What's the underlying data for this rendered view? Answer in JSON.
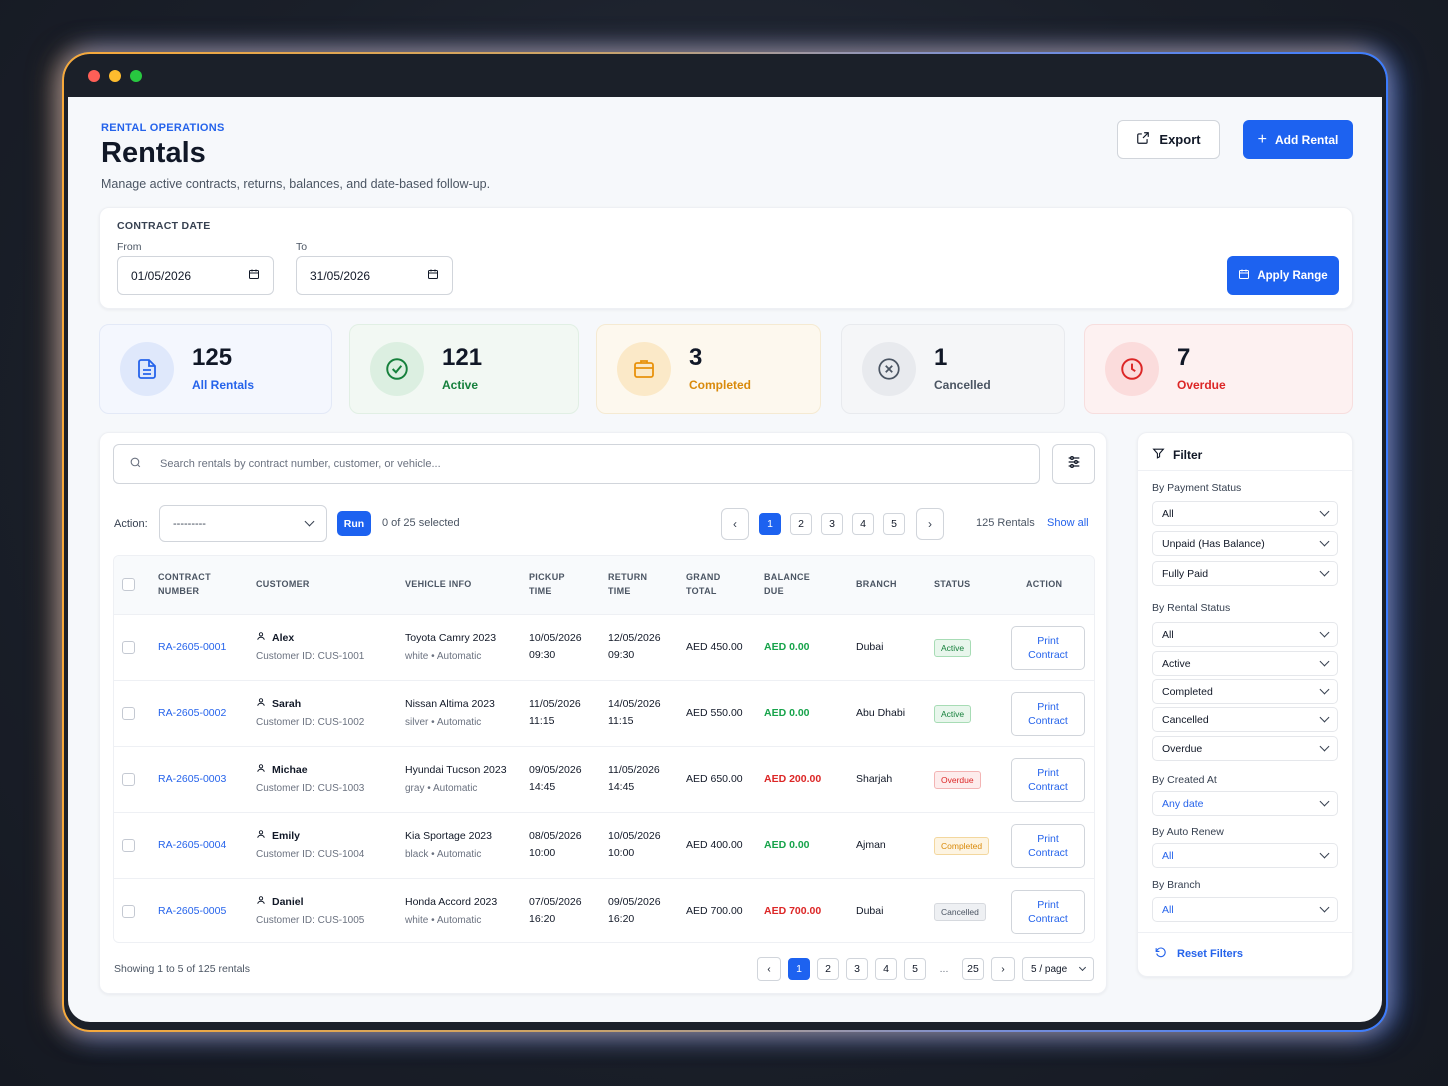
{
  "window": {
    "dot_colors": [
      "#ff5f57",
      "#febc2e",
      "#28c840"
    ]
  },
  "header": {
    "eyebrow": "RENTAL OPERATIONS",
    "title": "Rentals",
    "subtitle": "Manage active contracts, returns, balances, and date-based follow-up.",
    "export_label": "Export",
    "add_label": "Add Rental"
  },
  "date_range": {
    "section_label": "CONTRACT DATE",
    "from_label": "From",
    "from_value": "01/05/2026",
    "to_label": "To",
    "to_value": "31/05/2026",
    "apply_label": "Apply Range"
  },
  "stats": [
    {
      "value": "125",
      "label": "All Rentals",
      "color": "#2563eb"
    },
    {
      "value": "121",
      "label": "Active",
      "color": "#16803c"
    },
    {
      "value": "3",
      "label": "Completed",
      "color": "#d98a0b"
    },
    {
      "value": "1",
      "label": "Cancelled",
      "color": "#4b5563"
    },
    {
      "value": "7",
      "label": "Overdue",
      "color": "#dc2626"
    }
  ],
  "search": {
    "placeholder": "Search rentals by contract number, customer, or vehicle..."
  },
  "actions": {
    "action_label": "Action:",
    "action_value": "---------",
    "run_label": "Run",
    "selected_text": "0 of 25 selected",
    "top_pages": [
      "1",
      "2",
      "3",
      "4",
      "5"
    ],
    "total_text": "125 Rentals",
    "show_all": "Show all"
  },
  "table": {
    "headers": {
      "contract": "CONTRACT NUMBER",
      "customer": "CUSTOMER",
      "vehicle": "VEHICLE INFO",
      "pickup": "PICKUP TIME",
      "return": "RETURN TIME",
      "grand": "GRAND TOTAL",
      "balance": "BALANCE DUE",
      "branch": "BRANCH",
      "status": "STATUS",
      "action": "ACTION"
    },
    "rows": [
      {
        "contract": "RA-2605-0001",
        "name": "Alex",
        "cid": "Customer ID: CUS-1001",
        "vehicle": "Toyota Camry 2023",
        "spec": "white • Automatic",
        "pickup_date": "10/05/2026",
        "pickup_time": "09:30",
        "return_date": "12/05/2026",
        "return_time": "09:30",
        "grand": "AED 450.00",
        "balance": "AED 0.00",
        "balance_color": "#16a34a",
        "branch": "Dubai",
        "status": "Active",
        "status_kind": "active",
        "print1": "Print",
        "print2": "Contract"
      },
      {
        "contract": "RA-2605-0002",
        "name": "Sarah",
        "cid": "Customer ID: CUS-1002",
        "vehicle": "Nissan Altima 2023",
        "spec": "silver • Automatic",
        "pickup_date": "11/05/2026",
        "pickup_time": "11:15",
        "return_date": "14/05/2026",
        "return_time": "11:15",
        "grand": "AED 550.00",
        "balance": "AED 0.00",
        "balance_color": "#16a34a",
        "branch": "Abu Dhabi",
        "status": "Active",
        "status_kind": "active",
        "print1": "Print",
        "print2": "Contract"
      },
      {
        "contract": "RA-2605-0003",
        "name": "Michae",
        "cid": "Customer ID: CUS-1003",
        "vehicle": "Hyundai Tucson 2023",
        "spec": "gray • Automatic",
        "pickup_date": "09/05/2026",
        "pickup_time": "14:45",
        "return_date": "11/05/2026",
        "return_time": "14:45",
        "grand": "AED 650.00",
        "balance": "AED 200.00",
        "balance_color": "#dc2626",
        "branch": "Sharjah",
        "status": "Overdue",
        "status_kind": "overdue",
        "print1": "Print",
        "print2": "Contract"
      },
      {
        "contract": "RA-2605-0004",
        "name": "Emily",
        "cid": "Customer ID: CUS-1004",
        "vehicle": "Kia Sportage 2023",
        "spec": "black • Automatic",
        "pickup_date": "08/05/2026",
        "pickup_time": "10:00",
        "return_date": "10/05/2026",
        "return_time": "10:00",
        "grand": "AED 400.00",
        "balance": "AED 0.00",
        "balance_color": "#16a34a",
        "branch": "Ajman",
        "status": "Completed",
        "status_kind": "completed",
        "print1": "Print",
        "print2": "Contract"
      },
      {
        "contract": "RA-2605-0005",
        "name": "Daniel",
        "cid": "Customer ID: CUS-1005",
        "vehicle": "Honda Accord 2023",
        "spec": "white • Automatic",
        "pickup_date": "07/05/2026",
        "pickup_time": "16:20",
        "return_date": "09/05/2026",
        "return_time": "16:20",
        "grand": "AED 700.00",
        "balance": "AED 700.00",
        "balance_color": "#dc2626",
        "branch": "Dubai",
        "status": "Cancelled",
        "status_kind": "cancelled",
        "print1": "Print",
        "print2": "Contract"
      }
    ]
  },
  "footer": {
    "showing": "Showing 1 to 5 of 125 rentals",
    "pages": [
      "1",
      "2",
      "3",
      "4",
      "5",
      "...",
      "25"
    ],
    "per_page": "5 / page"
  },
  "filter": {
    "title": "Filter",
    "payment_label": "By Payment Status",
    "payment_options": [
      "All",
      "Unpaid (Has Balance)",
      "Fully Paid"
    ],
    "rental_label": "By Rental Status",
    "rental_options": [
      "All",
      "Active",
      "Completed",
      "Cancelled",
      "Overdue"
    ],
    "created_label": "By Created At",
    "created_value": "Any date",
    "renew_label": "By Auto Renew",
    "renew_value": "All",
    "branch_label": "By Branch",
    "branch_value": "All",
    "reset_label": "Reset Filters"
  }
}
